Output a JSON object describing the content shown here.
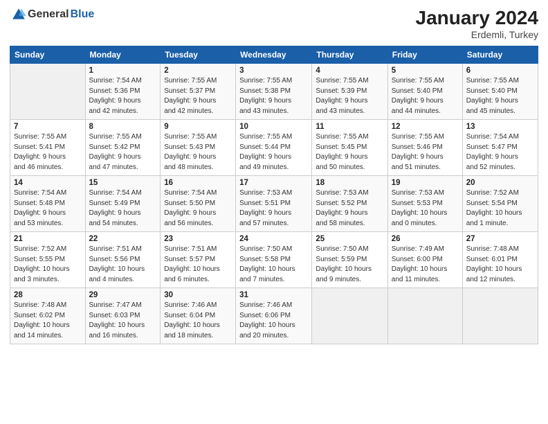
{
  "header": {
    "logo_general": "General",
    "logo_blue": "Blue",
    "title": "January 2024",
    "subtitle": "Erdemli, Turkey"
  },
  "calendar": {
    "days_of_week": [
      "Sunday",
      "Monday",
      "Tuesday",
      "Wednesday",
      "Thursday",
      "Friday",
      "Saturday"
    ],
    "weeks": [
      [
        {
          "day": "",
          "info": ""
        },
        {
          "day": "1",
          "info": "Sunrise: 7:54 AM\nSunset: 5:36 PM\nDaylight: 9 hours\nand 42 minutes."
        },
        {
          "day": "2",
          "info": "Sunrise: 7:55 AM\nSunset: 5:37 PM\nDaylight: 9 hours\nand 42 minutes."
        },
        {
          "day": "3",
          "info": "Sunrise: 7:55 AM\nSunset: 5:38 PM\nDaylight: 9 hours\nand 43 minutes."
        },
        {
          "day": "4",
          "info": "Sunrise: 7:55 AM\nSunset: 5:39 PM\nDaylight: 9 hours\nand 43 minutes."
        },
        {
          "day": "5",
          "info": "Sunrise: 7:55 AM\nSunset: 5:40 PM\nDaylight: 9 hours\nand 44 minutes."
        },
        {
          "day": "6",
          "info": "Sunrise: 7:55 AM\nSunset: 5:40 PM\nDaylight: 9 hours\nand 45 minutes."
        }
      ],
      [
        {
          "day": "7",
          "info": "Sunrise: 7:55 AM\nSunset: 5:41 PM\nDaylight: 9 hours\nand 46 minutes."
        },
        {
          "day": "8",
          "info": "Sunrise: 7:55 AM\nSunset: 5:42 PM\nDaylight: 9 hours\nand 47 minutes."
        },
        {
          "day": "9",
          "info": "Sunrise: 7:55 AM\nSunset: 5:43 PM\nDaylight: 9 hours\nand 48 minutes."
        },
        {
          "day": "10",
          "info": "Sunrise: 7:55 AM\nSunset: 5:44 PM\nDaylight: 9 hours\nand 49 minutes."
        },
        {
          "day": "11",
          "info": "Sunrise: 7:55 AM\nSunset: 5:45 PM\nDaylight: 9 hours\nand 50 minutes."
        },
        {
          "day": "12",
          "info": "Sunrise: 7:55 AM\nSunset: 5:46 PM\nDaylight: 9 hours\nand 51 minutes."
        },
        {
          "day": "13",
          "info": "Sunrise: 7:54 AM\nSunset: 5:47 PM\nDaylight: 9 hours\nand 52 minutes."
        }
      ],
      [
        {
          "day": "14",
          "info": "Sunrise: 7:54 AM\nSunset: 5:48 PM\nDaylight: 9 hours\nand 53 minutes."
        },
        {
          "day": "15",
          "info": "Sunrise: 7:54 AM\nSunset: 5:49 PM\nDaylight: 9 hours\nand 54 minutes."
        },
        {
          "day": "16",
          "info": "Sunrise: 7:54 AM\nSunset: 5:50 PM\nDaylight: 9 hours\nand 56 minutes."
        },
        {
          "day": "17",
          "info": "Sunrise: 7:53 AM\nSunset: 5:51 PM\nDaylight: 9 hours\nand 57 minutes."
        },
        {
          "day": "18",
          "info": "Sunrise: 7:53 AM\nSunset: 5:52 PM\nDaylight: 9 hours\nand 58 minutes."
        },
        {
          "day": "19",
          "info": "Sunrise: 7:53 AM\nSunset: 5:53 PM\nDaylight: 10 hours\nand 0 minutes."
        },
        {
          "day": "20",
          "info": "Sunrise: 7:52 AM\nSunset: 5:54 PM\nDaylight: 10 hours\nand 1 minute."
        }
      ],
      [
        {
          "day": "21",
          "info": "Sunrise: 7:52 AM\nSunset: 5:55 PM\nDaylight: 10 hours\nand 3 minutes."
        },
        {
          "day": "22",
          "info": "Sunrise: 7:51 AM\nSunset: 5:56 PM\nDaylight: 10 hours\nand 4 minutes."
        },
        {
          "day": "23",
          "info": "Sunrise: 7:51 AM\nSunset: 5:57 PM\nDaylight: 10 hours\nand 6 minutes."
        },
        {
          "day": "24",
          "info": "Sunrise: 7:50 AM\nSunset: 5:58 PM\nDaylight: 10 hours\nand 7 minutes."
        },
        {
          "day": "25",
          "info": "Sunrise: 7:50 AM\nSunset: 5:59 PM\nDaylight: 10 hours\nand 9 minutes."
        },
        {
          "day": "26",
          "info": "Sunrise: 7:49 AM\nSunset: 6:00 PM\nDaylight: 10 hours\nand 11 minutes."
        },
        {
          "day": "27",
          "info": "Sunrise: 7:48 AM\nSunset: 6:01 PM\nDaylight: 10 hours\nand 12 minutes."
        }
      ],
      [
        {
          "day": "28",
          "info": "Sunrise: 7:48 AM\nSunset: 6:02 PM\nDaylight: 10 hours\nand 14 minutes."
        },
        {
          "day": "29",
          "info": "Sunrise: 7:47 AM\nSunset: 6:03 PM\nDaylight: 10 hours\nand 16 minutes."
        },
        {
          "day": "30",
          "info": "Sunrise: 7:46 AM\nSunset: 6:04 PM\nDaylight: 10 hours\nand 18 minutes."
        },
        {
          "day": "31",
          "info": "Sunrise: 7:46 AM\nSunset: 6:06 PM\nDaylight: 10 hours\nand 20 minutes."
        },
        {
          "day": "",
          "info": ""
        },
        {
          "day": "",
          "info": ""
        },
        {
          "day": "",
          "info": ""
        }
      ]
    ]
  }
}
